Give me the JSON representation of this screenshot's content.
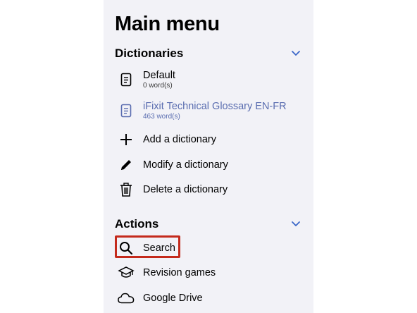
{
  "title": "Main menu",
  "sections": {
    "dictionaries": {
      "header": "Dictionaries",
      "items": [
        {
          "label": "Default",
          "sub": "0 word(s)",
          "icon": "document-icon"
        },
        {
          "label": "iFixit Technical Glossary EN-FR",
          "sub": "463 word(s)",
          "icon": "document-icon",
          "selected": true
        },
        {
          "label": "Add a dictionary",
          "icon": "plus-icon"
        },
        {
          "label": "Modify a dictionary",
          "icon": "pencil-icon"
        },
        {
          "label": "Delete a dictionary",
          "icon": "trash-icon"
        }
      ]
    },
    "actions": {
      "header": "Actions",
      "items": [
        {
          "label": "Search",
          "icon": "search-icon",
          "highlighted": true
        },
        {
          "label": "Revision games",
          "icon": "graduation-cap-icon"
        },
        {
          "label": "Google Drive",
          "icon": "cloud-icon"
        }
      ]
    }
  },
  "colors": {
    "background": "#f2f2f7",
    "selected_text": "#5a6db0",
    "chevron": "#3a66c8",
    "highlight_border": "#c42a1c"
  }
}
